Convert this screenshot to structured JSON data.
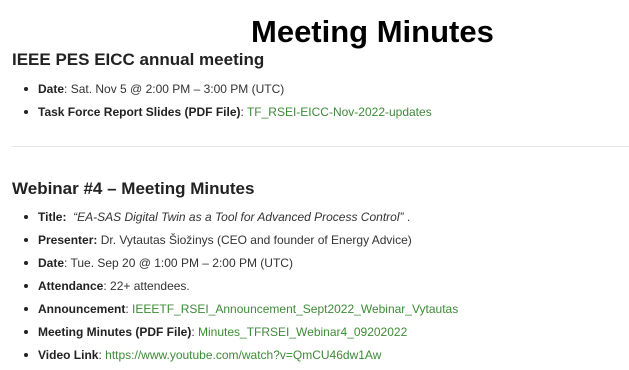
{
  "page": {
    "title": "Meeting Minutes"
  },
  "colors": {
    "link": "#3d8b37",
    "text": "#222222",
    "divider": "#e6e6e6"
  },
  "section1": {
    "heading": "IEEE PES EICC annual meeting",
    "date_label": "Date",
    "date_sep": ": ",
    "date_value": "Sat. Nov 5 @ 2:00 PM – 3:00 PM (UTC)",
    "slides_label": "Task Force Report Slides (PDF File)",
    "slides_sep": ": ",
    "slides_link": "TF_RSEI-EICC-Nov-2022-updates"
  },
  "section2": {
    "heading": "Webinar #4 – Meeting Minutes",
    "title_label": "Title:",
    "title_value": "“EA-SAS Digital Twin as a Tool for Advanced Process Control”",
    "title_end": " .",
    "presenter_label": "Presenter:",
    "presenter_value": " Dr. Vytautas Šiožinys (CEO and founder of Energy Advice)",
    "date_label": "Date",
    "date_sep": ": ",
    "date_value": "Tue. Sep 20 @ 1:00 PM – 2:00 PM (UTC)",
    "attendance_label": "Attendance",
    "attendance_sep": ": ",
    "attendance_value": "22+ attendees.",
    "announcement_label": "Announcement",
    "announcement_sep": ": ",
    "announcement_link": "IEEETF_RSEI_Announcement_Sept2022_Webinar_Vytautas",
    "minutes_label": "Meeting Minutes (PDF File)",
    "minutes_sep": ": ",
    "minutes_link": "Minutes_TFRSEI_Webinar4_09202022",
    "video_label": "Video Link",
    "video_sep": ": ",
    "video_link": "https://www.youtube.com/watch?v=QmCU46dw1Aw"
  }
}
